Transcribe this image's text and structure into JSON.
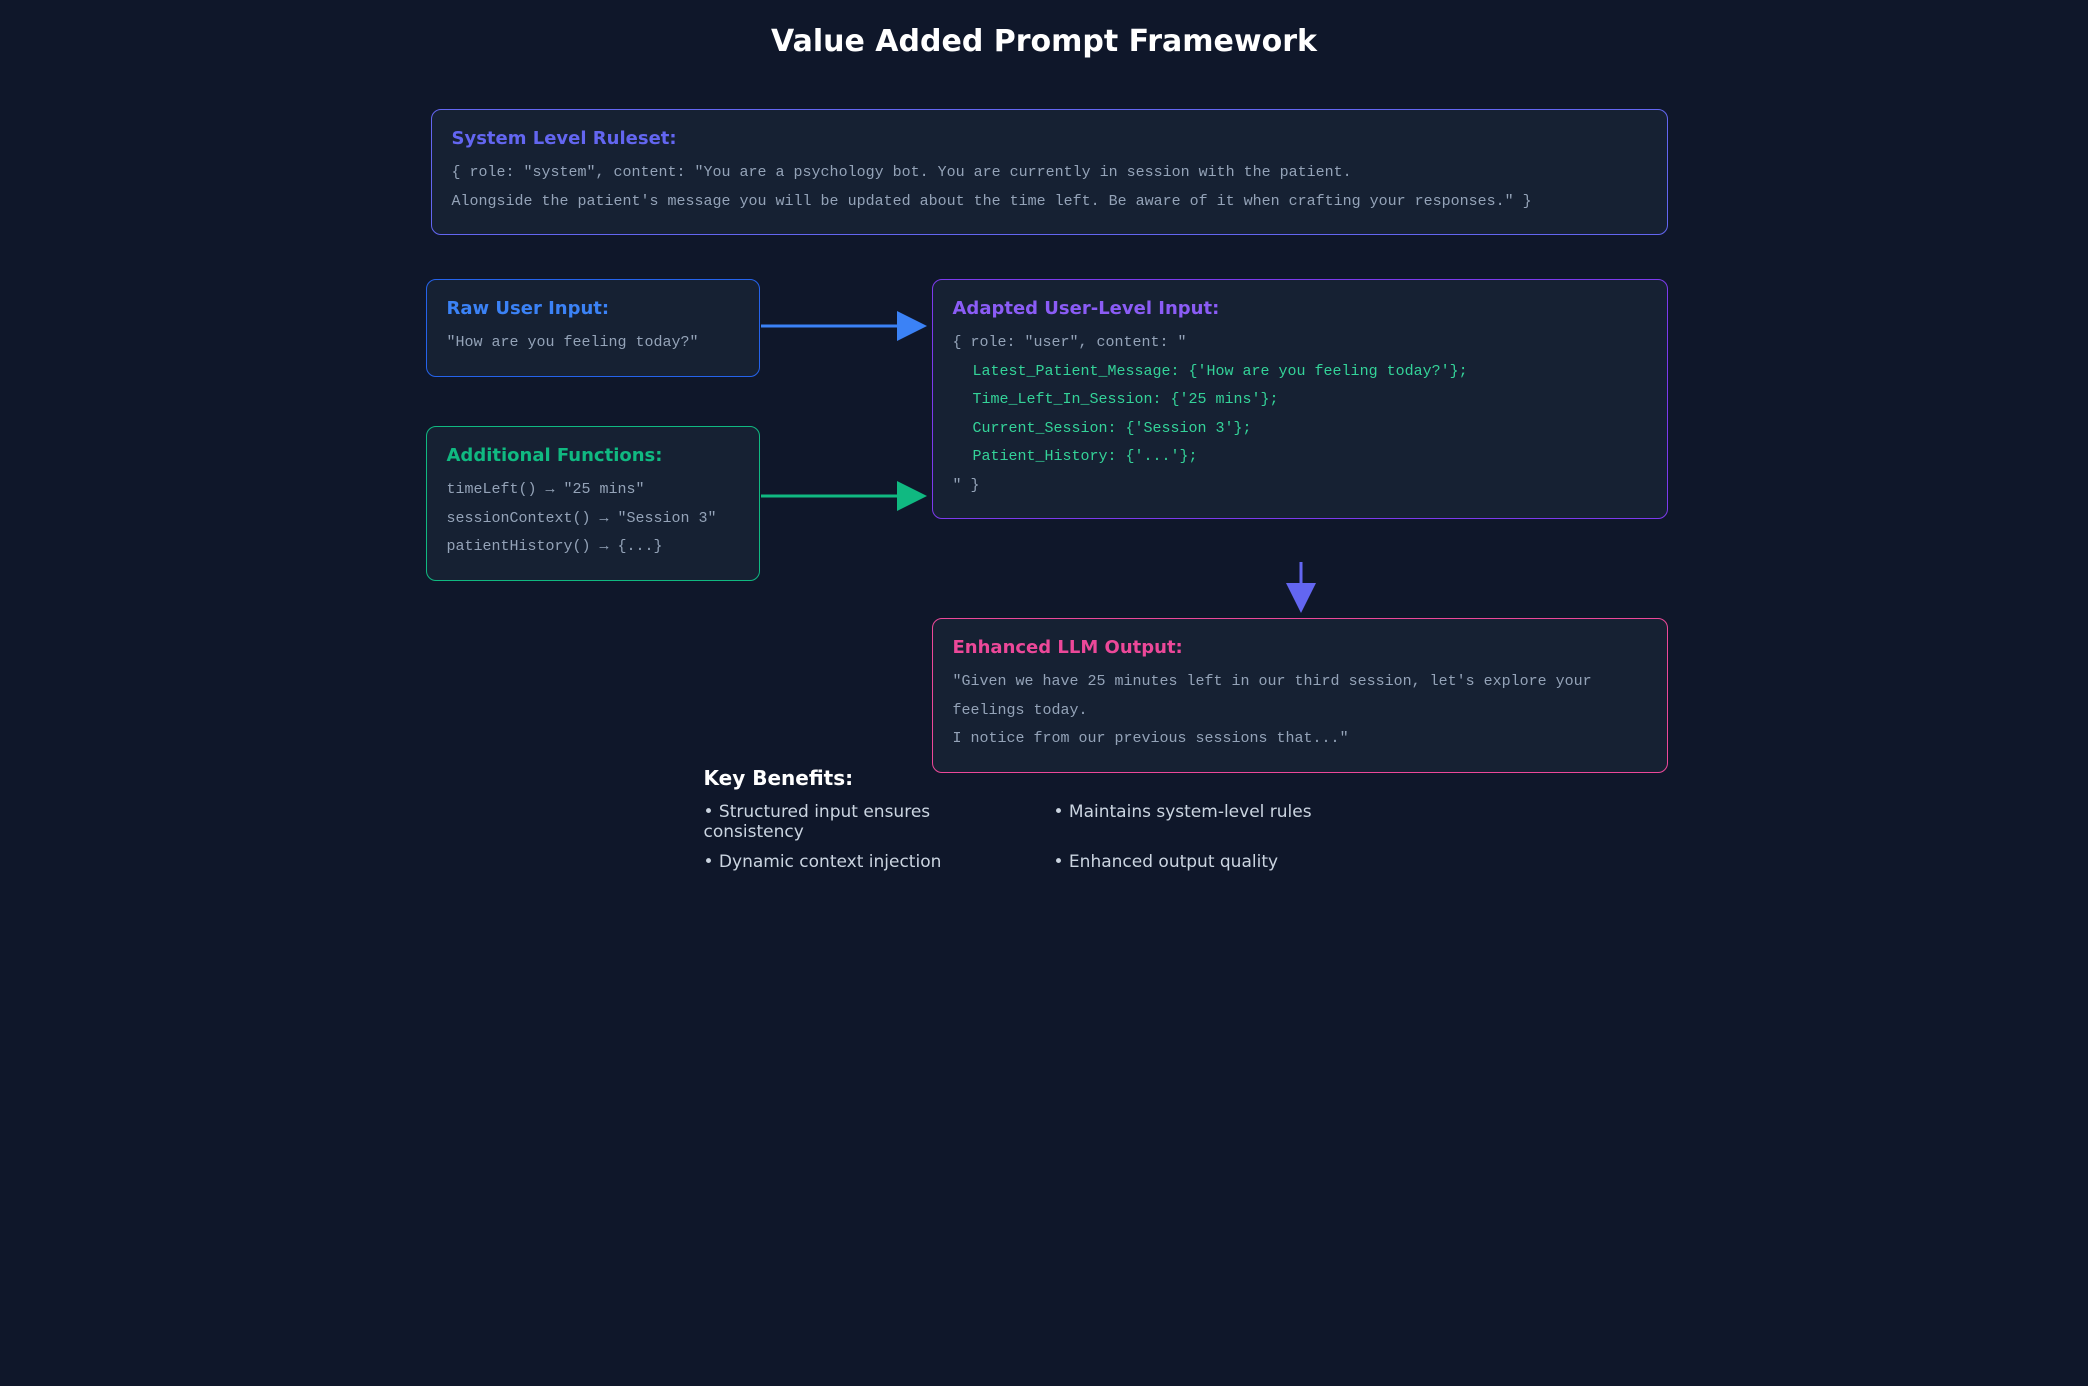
{
  "title": "Value Added Prompt Framework",
  "system": {
    "heading": "System Level Ruleset:",
    "content": "{ role: \"system\", content: \"You are a psychology bot. You are currently in session with the patient.\nAlongside the patient's message you will be updated about the time left. Be aware of it when crafting your responses.\" }"
  },
  "raw_input": {
    "heading": "Raw User Input:",
    "content": "\"How are you feeling today?\""
  },
  "functions": {
    "heading": "Additional Functions:",
    "lines": [
      "timeLeft() → \"25 mins\"",
      "sessionContext() → \"Session 3\"",
      "patientHistory() → {...}"
    ]
  },
  "adapted": {
    "heading": "Adapted User-Level Input:",
    "open": "{ role: \"user\", content: \"",
    "fields": [
      "Latest_Patient_Message: {'How are you feeling today?'};",
      "Time_Left_In_Session: {'25 mins'};",
      "Current_Session: {'Session 3'};",
      "Patient_History: {'...'};"
    ],
    "close": "\" }"
  },
  "output": {
    "heading": "Enhanced LLM Output:",
    "content": "\"Given we have 25 minutes left in our third session, let's explore your feelings today.\nI notice from our previous sessions that...\""
  },
  "benefits": {
    "heading": "Key Benefits:",
    "items": [
      "• Structured input ensures consistency",
      "• Maintains system-level rules",
      "• Dynamic context injection",
      "• Enhanced output quality"
    ]
  }
}
